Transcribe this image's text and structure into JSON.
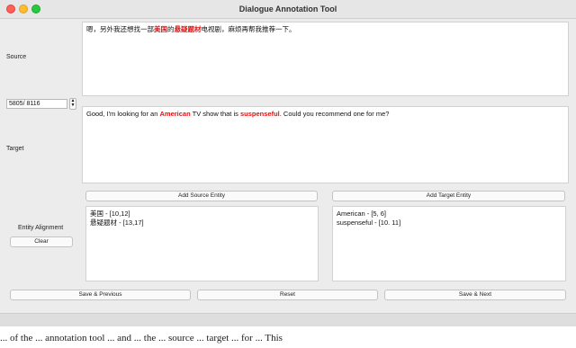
{
  "window": {
    "title": "Dialogue Annotation Tool"
  },
  "labels": {
    "source": "Source",
    "target": "Target",
    "entity_alignment": "Entity Alignment"
  },
  "counter": {
    "value": "5805/ 8116"
  },
  "source_text": {
    "p1": "嗯，另外我还想找一部",
    "h1": "美国",
    "p2": "的",
    "h2": "悬疑题材",
    "p3": "电视剧，麻烦再帮我推荐一下。"
  },
  "target_text": {
    "p1": "Good, I'm looking for an ",
    "h1": "American",
    "p2": " TV show that is ",
    "h2": "suspenseful",
    "p3": ". Could you recommend one for me?"
  },
  "buttons": {
    "add_source": "Add Source Entity",
    "add_target": "Add Target Entity",
    "clear": "Clear",
    "save_prev": "Save & Previous",
    "reset": "Reset",
    "save_next": "Save & Next"
  },
  "source_entities": [
    "美国 - [10,12]",
    "悬疑题材 - [13,17]"
  ],
  "target_entities": [
    "American - [5, 6]",
    "suspenseful - [10. 11]"
  ],
  "colors": {
    "highlight": "#e01010"
  },
  "below_window_text": "... of the ... annotation tool ... and ... the ... source ... target ... for ... This"
}
